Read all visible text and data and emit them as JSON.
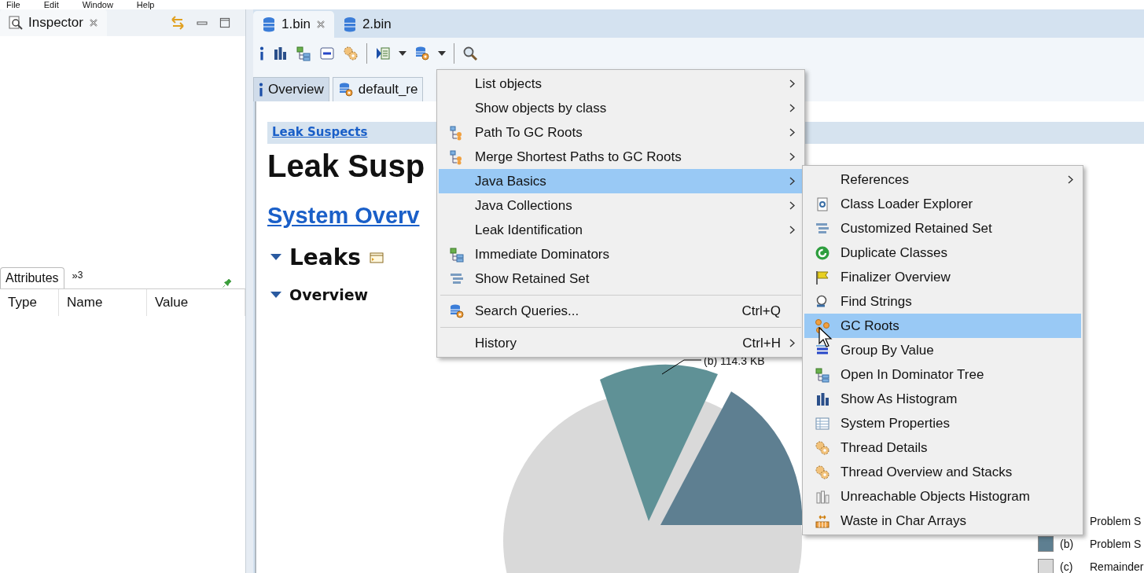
{
  "menubar": [
    {
      "label": "File"
    },
    {
      "label": "Edit"
    },
    {
      "label": "Window"
    },
    {
      "label": "Help"
    }
  ],
  "inspector": {
    "title": "Inspector"
  },
  "attributes": {
    "tab": "Attributes",
    "overflow_glyph": "»",
    "overflow_count": "3",
    "columns": [
      "Type",
      "Name",
      "Value"
    ]
  },
  "editor_tabs": [
    {
      "label": "1.bin",
      "selected": true,
      "closable": true
    },
    {
      "label": "2.bin",
      "selected": false,
      "closable": false
    }
  ],
  "sub_tabs": [
    {
      "label": "Overview",
      "selected": false
    },
    {
      "label": "default_re",
      "selected": true
    }
  ],
  "report": {
    "breadcrumb": "Leak Suspects",
    "title": "Leak Susp",
    "link": "System Overv",
    "section": "Leaks",
    "subsection": "Overview",
    "chart": {
      "slice_label": "(b)  114.3 KB",
      "legend": [
        {
          "text": "Problem S"
        },
        {
          "marker": "(b)",
          "text": "Problem S",
          "color": "#5e7f91"
        },
        {
          "marker": "(c)",
          "text": "Remainder",
          "color": "#d9d9d9"
        }
      ]
    }
  },
  "context_menu": {
    "items": [
      {
        "kind": "item",
        "label": "List objects",
        "submenu": true,
        "selected": false
      },
      {
        "kind": "item",
        "label": "Show objects by class",
        "submenu": true,
        "selected": false
      },
      {
        "kind": "item",
        "label": "Path To GC Roots",
        "submenu": true,
        "selected": false
      },
      {
        "kind": "item",
        "label": "Merge Shortest Paths to GC Roots",
        "submenu": true,
        "selected": false
      },
      {
        "kind": "item",
        "label": "Java Basics",
        "submenu": true,
        "selected": true
      },
      {
        "kind": "item",
        "label": "Java Collections",
        "submenu": true,
        "selected": false
      },
      {
        "kind": "item",
        "label": "Leak Identification",
        "submenu": true,
        "selected": false
      },
      {
        "kind": "item",
        "label": "Immediate Dominators",
        "submenu": false,
        "selected": false
      },
      {
        "kind": "item",
        "label": "Show Retained Set",
        "submenu": false,
        "selected": false
      },
      {
        "kind": "separator"
      },
      {
        "kind": "item",
        "label": "Search Queries...",
        "shortcut": "Ctrl+Q",
        "submenu": false,
        "selected": false
      },
      {
        "kind": "separator"
      },
      {
        "kind": "item",
        "label": "History",
        "shortcut": "Ctrl+H",
        "submenu": true,
        "selected": false
      }
    ]
  },
  "submenu": {
    "items": [
      {
        "kind": "item",
        "label": "References",
        "submenu": true,
        "selected": false
      },
      {
        "kind": "item",
        "label": "Class Loader Explorer",
        "submenu": false,
        "selected": false
      },
      {
        "kind": "item",
        "label": "Customized Retained Set",
        "submenu": false,
        "selected": false
      },
      {
        "kind": "item",
        "label": "Duplicate Classes",
        "submenu": false,
        "selected": false
      },
      {
        "kind": "item",
        "label": "Finalizer Overview",
        "submenu": false,
        "selected": false
      },
      {
        "kind": "item",
        "label": "Find Strings",
        "submenu": false,
        "selected": false
      },
      {
        "kind": "item",
        "label": "GC Roots",
        "submenu": false,
        "selected": true
      },
      {
        "kind": "item",
        "label": "Group By Value",
        "submenu": false,
        "selected": false
      },
      {
        "kind": "item",
        "label": "Open In Dominator Tree",
        "submenu": false,
        "selected": false
      },
      {
        "kind": "item",
        "label": "Show As Histogram",
        "submenu": false,
        "selected": false
      },
      {
        "kind": "item",
        "label": "System Properties",
        "submenu": false,
        "selected": false
      },
      {
        "kind": "item",
        "label": "Thread Details",
        "submenu": false,
        "selected": false
      },
      {
        "kind": "item",
        "label": "Thread Overview and Stacks",
        "submenu": false,
        "selected": false
      },
      {
        "kind": "item",
        "label": "Unreachable Objects Histogram",
        "submenu": false,
        "selected": false
      },
      {
        "kind": "item",
        "label": "Waste in Char Arrays",
        "submenu": false,
        "selected": false
      }
    ]
  }
}
